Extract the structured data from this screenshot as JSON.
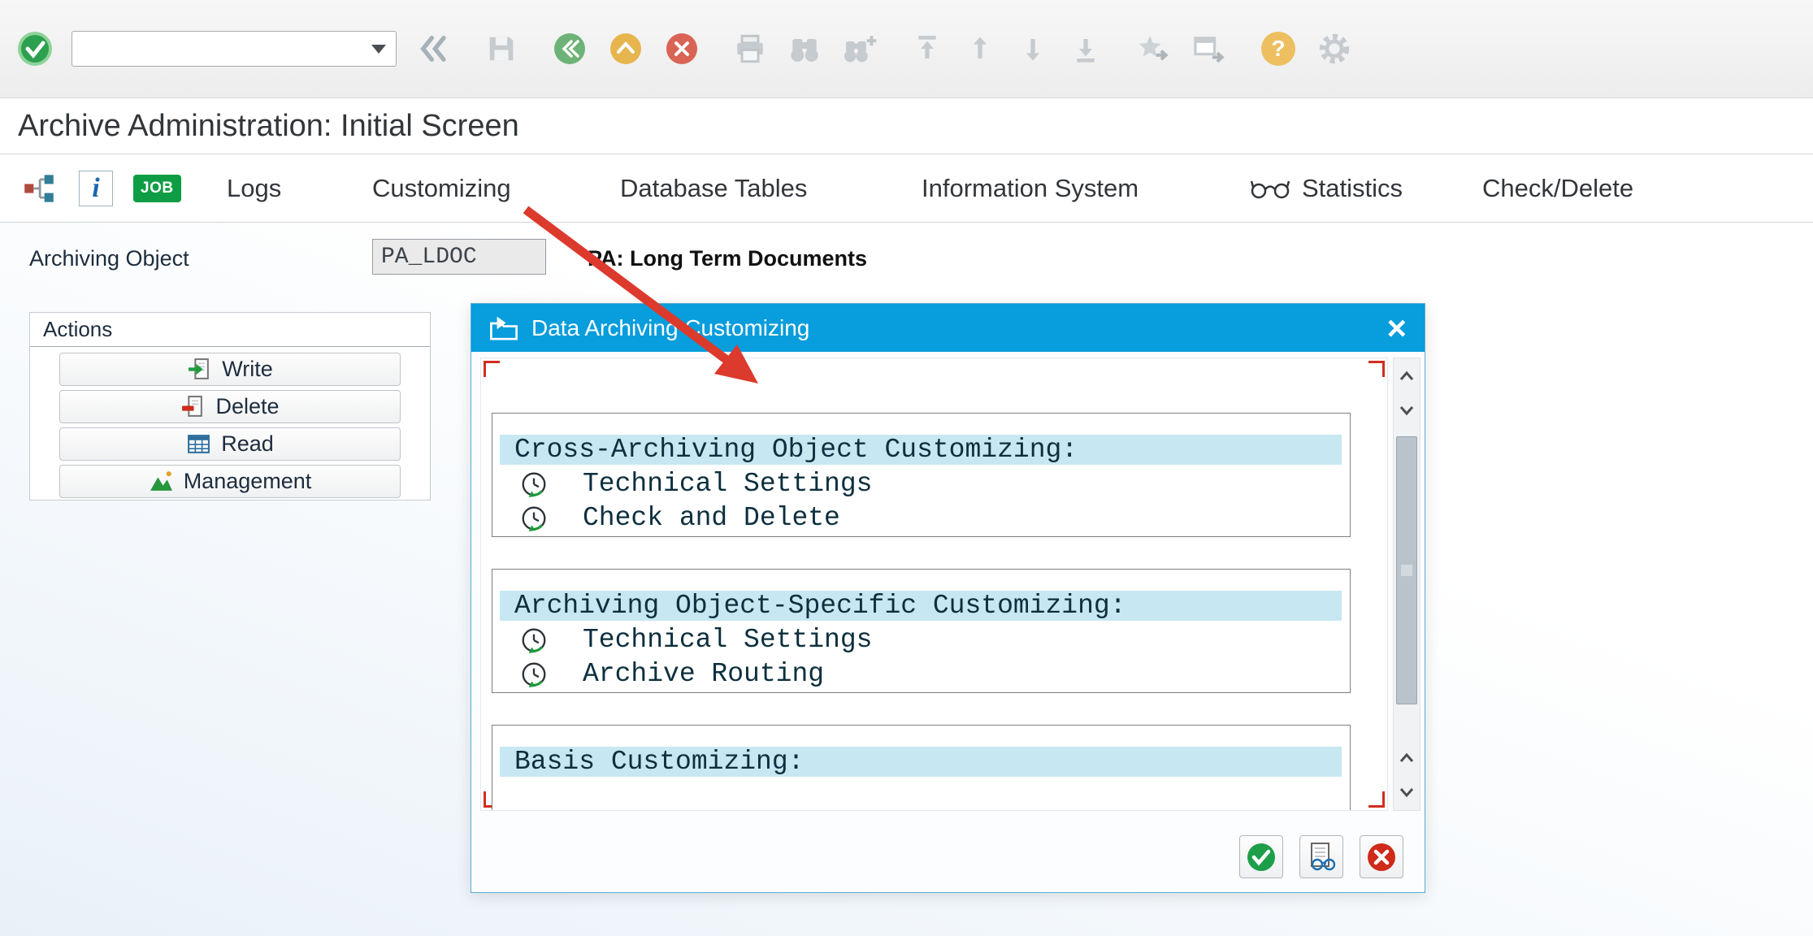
{
  "glyphs": {
    "question": "?",
    "close": "×",
    "info": "i"
  },
  "toolbar": {
    "command_value": ""
  },
  "header": {
    "title": "Archive Administration: Initial Screen"
  },
  "app_toolbar": {
    "job_label": "JOB",
    "buttons": [
      {
        "label": "Logs"
      },
      {
        "label": "Customizing"
      },
      {
        "label": "Database Tables"
      },
      {
        "label": "Information System"
      },
      {
        "label": "Statistics"
      },
      {
        "label": "Check/Delete"
      }
    ]
  },
  "form": {
    "label": "Archiving Object",
    "value": "PA_LDOC",
    "description": "PA: Long Term Documents"
  },
  "actions": {
    "title": "Actions",
    "buttons": [
      {
        "label": "Write"
      },
      {
        "label": "Delete"
      },
      {
        "label": "Read"
      },
      {
        "label": "Management"
      }
    ]
  },
  "dialog": {
    "title": "Data Archiving Customizing",
    "groups": [
      {
        "header": "Cross-Archiving Object Customizing:",
        "items": [
          {
            "label": "Technical Settings"
          },
          {
            "label": "Check and Delete"
          }
        ]
      },
      {
        "header": "Archiving Object-Specific Customizing:",
        "items": [
          {
            "label": "Technical Settings"
          },
          {
            "label": "Archive Routing"
          }
        ]
      },
      {
        "header": "Basis Customizing:",
        "items": []
      }
    ]
  },
  "colors": {
    "dialog_titlebar": "#089ddc",
    "group_header_highlight": "#c7e8f2",
    "annotation_arrow": "#dc3a2c",
    "job_badge": "#0e9d44"
  }
}
